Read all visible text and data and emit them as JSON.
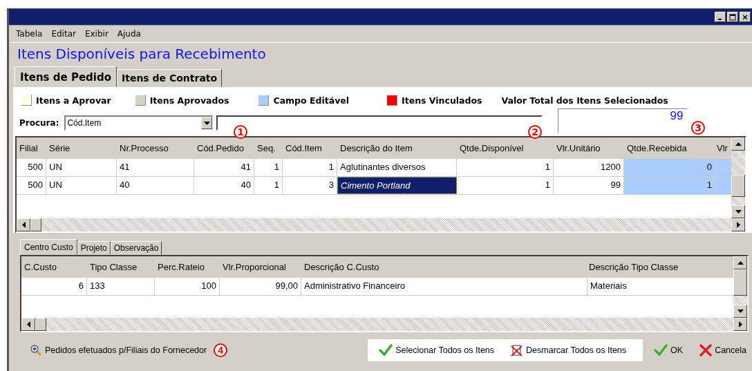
{
  "menu": [
    "Tabela",
    "Editar",
    "Exibir",
    "Ajuda"
  ],
  "heading": "Itens Disponíveis para Recebimento",
  "tabs": [
    {
      "label": "Itens de Pedido",
      "selected": true
    },
    {
      "label": "Itens de Contrato",
      "selected": false
    }
  ],
  "legend": [
    {
      "label": "Itens a Aprovar",
      "color": "#ffffe1"
    },
    {
      "label": "Itens Aprovados",
      "color": "#d4d0c8"
    },
    {
      "label": "Campo Editável",
      "color": "#aaccff"
    },
    {
      "label": "Itens Vinculados",
      "color": "#ff0000"
    }
  ],
  "total": {
    "label": "Valor Total dos Itens Selecionados",
    "value": "99"
  },
  "search": {
    "label": "Procura:",
    "field": "Cód.Item"
  },
  "markers": [
    "1",
    "2",
    "3",
    "4"
  ],
  "table": {
    "columns": [
      {
        "label": "Filial",
        "editable": false
      },
      {
        "label": "Série",
        "editable": false
      },
      {
        "label": "Nr.Processo",
        "editable": false
      },
      {
        "label": "Cód.Pedido",
        "editable": false
      },
      {
        "label": "Seq.",
        "editable": false
      },
      {
        "label": "Cód.Item",
        "editable": false
      },
      {
        "label": "Descrição do Item",
        "editable": false
      },
      {
        "label": "Qtde.Disponível",
        "editable": false
      },
      {
        "label": "Vlr.Unitário",
        "editable": false
      },
      {
        "label": "Qtde.Recebida",
        "editable": true
      },
      {
        "label": "Vlr",
        "editable": true
      }
    ],
    "rows": [
      {
        "cells": [
          {
            "text": "500",
            "selected": false
          },
          {
            "text": "UN",
            "selected": false
          },
          {
            "text": "41",
            "selected": false
          },
          {
            "text": "41",
            "selected": false
          },
          {
            "text": "1",
            "selected": false
          },
          {
            "text": "1",
            "selected": false
          },
          {
            "text": "Aglutinantes diversos",
            "selected": false
          },
          {
            "text": "1",
            "selected": false
          },
          {
            "text": "1200",
            "selected": false
          },
          {
            "text": "0",
            "selected": false
          }
        ]
      },
      {
        "cells": [
          {
            "text": "500",
            "selected": false
          },
          {
            "text": "UN",
            "selected": false
          },
          {
            "text": "40",
            "selected": false
          },
          {
            "text": "40",
            "selected": false
          },
          {
            "text": "1",
            "selected": false
          },
          {
            "text": "3",
            "selected": false
          },
          {
            "text": "Cimento Portland",
            "selected": true
          },
          {
            "text": "1",
            "selected": false
          },
          {
            "text": "99",
            "selected": false
          },
          {
            "text": "1",
            "selected": false
          }
        ]
      }
    ]
  },
  "subtabs": [
    {
      "label": "Centro Custo",
      "selected": true
    },
    {
      "label": "Projeto",
      "selected": false
    },
    {
      "label": "Observação",
      "selected": false
    }
  ],
  "subtable": {
    "columns": [
      "C.Custo",
      "Tipo Classe",
      "Perc.Rateio",
      "Vlr.Proporcional",
      "Descrição C.Custo",
      "Descrição Tipo Classe"
    ],
    "rows": [
      [
        "6",
        "133",
        "100",
        "99,00",
        "Administrativo Financeiro",
        "Materiais"
      ]
    ]
  },
  "footer": {
    "link": "Pedidos efetuados p/Filiais do Fornecedor",
    "buttons": [
      {
        "label": "Selecionar Todos os Itens",
        "kind": "check",
        "highlight": true
      },
      {
        "label": "Desmarcar Todos os Itens",
        "kind": "uncheck",
        "highlight": true
      },
      {
        "label": "OK",
        "kind": "check",
        "highlight": false
      },
      {
        "label": "Cancela",
        "kind": "cancel",
        "highlight": false
      }
    ]
  }
}
